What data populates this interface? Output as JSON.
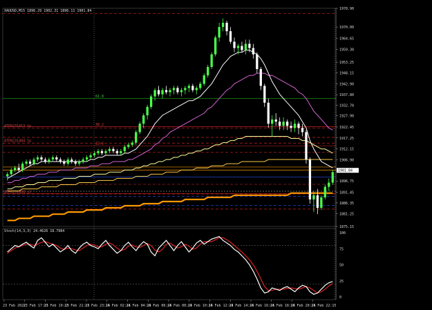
{
  "symbol_header": "XAUUSD,M15  1896.29 1902.31 1896.11 1901.84",
  "stoch_header": "Stoch(14,3,3) 24.4626 18.7984",
  "price_axis": {
    "ticks": [
      {
        "v": 1978.9,
        "t": "1978.90"
      },
      {
        "v": 1970.0,
        "t": "1970.00"
      },
      {
        "v": 1964.65,
        "t": "1964.65"
      },
      {
        "v": 1959.3,
        "t": "1959.30"
      },
      {
        "v": 1953.25,
        "t": "1953.25"
      },
      {
        "v": 1948.15,
        "t": "1948.15"
      },
      {
        "v": 1942.9,
        "t": "1942.90"
      },
      {
        "v": 1937.8,
        "t": "1937.80"
      },
      {
        "v": 1932.7,
        "t": "1932.70"
      },
      {
        "v": 1927.9,
        "t": "1927.90"
      },
      {
        "v": 1922.45,
        "t": "1922.45"
      },
      {
        "v": 1917.25,
        "t": "1917.25"
      },
      {
        "v": 1912.15,
        "t": "1912.15"
      },
      {
        "v": 1906.9,
        "t": "1906.90"
      },
      {
        "v": 1901.84,
        "t": "1901.84"
      },
      {
        "v": 1896.75,
        "t": "1896.75"
      },
      {
        "v": 1891.45,
        "t": "1891.45"
      },
      {
        "v": 1886.35,
        "t": "1886.35"
      },
      {
        "v": 1881.25,
        "t": "1881.25"
      },
      {
        "v": 1875.15,
        "t": "1875.15"
      }
    ],
    "current": 1901.84,
    "current_label": "1901.84"
  },
  "stoch_axis": {
    "ticks": [
      {
        "v": 100,
        "t": "100"
      },
      {
        "v": 75,
        "t": "75"
      },
      {
        "v": 50,
        "t": "50"
      },
      {
        "v": 25,
        "t": "25"
      },
      {
        "v": 0,
        "t": "0"
      }
    ]
  },
  "time_axis": {
    "labels": [
      "23 Feb 2022",
      "23 Feb 17:15",
      "23 Feb 19:15",
      "23 Feb 21:15",
      "23 Feb 23:15",
      "24 Feb 02:15",
      "24 Feb 04:15",
      "24 Feb 06:15",
      "24 Feb 08:15",
      "24 Feb 10:15",
      "24 Feb 12:15",
      "24 Feb 14:15",
      "24 Feb 16:15",
      "24 Feb 18:15",
      "24 Feb 20:15",
      "24 Feb 22:15"
    ]
  },
  "levels": [
    {
      "p": 1976.5,
      "color": "#cc2222",
      "dash": "4,3",
      "label": ""
    },
    {
      "p": 1936.0,
      "color": "#22aa22",
      "dash": "",
      "label": "61.8"
    },
    {
      "p": 1922.6,
      "color": "#cc2222",
      "dash": "",
      "label": "38.2"
    },
    {
      "p": 1922.0,
      "color": "#cc2222",
      "dash": "4,3",
      "label": "ATP8231413 tp"
    },
    {
      "p": 1914.8,
      "color": "#cc2222",
      "dash": "4,3",
      "label": "ATP8231404 tp"
    },
    {
      "p": 1917.5,
      "color": "#cc2222",
      "dash": "4,3",
      "label": ""
    },
    {
      "p": 1913.5,
      "color": "#aa2222",
      "dash": "",
      "label": "23.6"
    },
    {
      "p": 1910.5,
      "color": "#cc2222",
      "dash": "4,3",
      "label": ""
    },
    {
      "p": 1903.4,
      "color": "#ff9900",
      "dash": "",
      "label": ""
    },
    {
      "p": 1902.0,
      "color": "#ff9900",
      "dash": "",
      "label": ""
    },
    {
      "p": 1898.7,
      "color": "#2244cc",
      "dash": "",
      "label": ""
    },
    {
      "p": 1895.2,
      "color": "#cc2222",
      "dash": "4,3",
      "label": ""
    },
    {
      "p": 1891.9,
      "color": "#888888",
      "dash": "2,2",
      "label": ""
    },
    {
      "p": 1890.8,
      "color": "#cc2222",
      "dash": "",
      "label": ""
    },
    {
      "p": 1890.6,
      "color": "#cc2222",
      "dash": "4,3",
      "label": "ATP8231404 sl"
    },
    {
      "p": 1889.4,
      "color": "#2244cc",
      "dash": "4,3",
      "label": ""
    },
    {
      "p": 1885.2,
      "color": "#2244cc",
      "dash": "4,3",
      "label": ""
    },
    {
      "p": 1883.4,
      "color": "#cc2222",
      "dash": "4,3",
      "label": ""
    }
  ],
  "colors": {
    "bull": "#4aff4a",
    "bear": "#ffffff",
    "ma_fast": "#ffffff",
    "ma_mid": "#d264d2",
    "ma_slow1": "#ffff99",
    "ma_slow2": "#ffcc44",
    "ma_slow3": "#ff9900",
    "stoch_main": "#ffffff",
    "stoch_signal": "#dd2222",
    "current_bg": "#ffffff"
  },
  "chart_data": {
    "type": "candlestick",
    "symbol": "XAUUSD",
    "timeframe": "M15",
    "ylim": [
      1875.15,
      1978.9
    ],
    "candles": [
      [
        1899,
        1901,
        1897,
        1900
      ],
      [
        1900,
        1903,
        1899,
        1902
      ],
      [
        1902,
        1904,
        1901,
        1903
      ],
      [
        1903,
        1905,
        1901,
        1902
      ],
      [
        1902,
        1906,
        1901,
        1905
      ],
      [
        1905,
        1907,
        1904,
        1906
      ],
      [
        1906,
        1907,
        1904,
        1905
      ],
      [
        1905,
        1908,
        1904,
        1907
      ],
      [
        1907,
        1909,
        1906,
        1908
      ],
      [
        1908,
        1909,
        1906,
        1907
      ],
      [
        1907,
        1908,
        1905,
        1906
      ],
      [
        1906,
        1908,
        1905,
        1907
      ],
      [
        1907,
        1909,
        1906,
        1908
      ],
      [
        1908,
        1909,
        1906,
        1907
      ],
      [
        1907,
        1908,
        1905,
        1906
      ],
      [
        1906,
        1907,
        1904,
        1905
      ],
      [
        1905,
        1908,
        1904,
        1907
      ],
      [
        1907,
        1908,
        1905,
        1906
      ],
      [
        1906,
        1907,
        1904,
        1905
      ],
      [
        1905,
        1907,
        1904,
        1906
      ],
      [
        1906,
        1908,
        1905,
        1907
      ],
      [
        1907,
        1909,
        1906,
        1908
      ],
      [
        1908,
        1910,
        1907,
        1909
      ],
      [
        1909,
        1911,
        1908,
        1910
      ],
      [
        1910,
        1912,
        1909,
        1911
      ],
      [
        1911,
        1912,
        1909,
        1910
      ],
      [
        1910,
        1912,
        1909,
        1911
      ],
      [
        1911,
        1913,
        1910,
        1912
      ],
      [
        1912,
        1913,
        1910,
        1911
      ],
      [
        1911,
        1912,
        1909,
        1910
      ],
      [
        1910,
        1912,
        1909,
        1911
      ],
      [
        1911,
        1914,
        1910,
        1913
      ],
      [
        1913,
        1915,
        1912,
        1914
      ],
      [
        1914,
        1916,
        1913,
        1915
      ],
      [
        1915,
        1921,
        1914,
        1920
      ],
      [
        1920,
        1925,
        1919,
        1924
      ],
      [
        1924,
        1929,
        1922,
        1928
      ],
      [
        1928,
        1933,
        1926,
        1932
      ],
      [
        1932,
        1938,
        1931,
        1937
      ],
      [
        1937,
        1941,
        1935,
        1940
      ],
      [
        1940,
        1942,
        1937,
        1938
      ],
      [
        1938,
        1941,
        1936,
        1940
      ],
      [
        1940,
        1942,
        1938,
        1939
      ],
      [
        1939,
        1941,
        1937,
        1940
      ],
      [
        1940,
        1942,
        1938,
        1941
      ],
      [
        1941,
        1942,
        1938,
        1939
      ],
      [
        1939,
        1941,
        1937,
        1940
      ],
      [
        1940,
        1942,
        1938,
        1941
      ],
      [
        1941,
        1943,
        1939,
        1942
      ],
      [
        1942,
        1943,
        1939,
        1940
      ],
      [
        1940,
        1942,
        1938,
        1941
      ],
      [
        1941,
        1944,
        1940,
        1943
      ],
      [
        1943,
        1948,
        1942,
        1947
      ],
      [
        1947,
        1952,
        1946,
        1951
      ],
      [
        1951,
        1958,
        1950,
        1957
      ],
      [
        1957,
        1966,
        1956,
        1965
      ],
      [
        1965,
        1972,
        1963,
        1970
      ],
      [
        1970,
        1974,
        1968,
        1972
      ],
      [
        1972,
        1973,
        1966,
        1968
      ],
      [
        1968,
        1970,
        1962,
        1963
      ],
      [
        1963,
        1965,
        1958,
        1960
      ],
      [
        1960,
        1962,
        1957,
        1961
      ],
      [
        1961,
        1963,
        1958,
        1959
      ],
      [
        1959,
        1964,
        1957,
        1962
      ],
      [
        1962,
        1964,
        1958,
        1960
      ],
      [
        1960,
        1962,
        1955,
        1957
      ],
      [
        1957,
        1958,
        1948,
        1950
      ],
      [
        1950,
        1951,
        1940,
        1942
      ],
      [
        1942,
        1943,
        1932,
        1934
      ],
      [
        1934,
        1936,
        1922,
        1924
      ],
      [
        1924,
        1928,
        1918,
        1926
      ],
      [
        1926,
        1929,
        1923,
        1925
      ],
      [
        1925,
        1927,
        1921,
        1923
      ],
      [
        1923,
        1927,
        1921,
        1925
      ],
      [
        1925,
        1926,
        1921,
        1923
      ],
      [
        1923,
        1925,
        1920,
        1922
      ],
      [
        1922,
        1926,
        1920,
        1924
      ],
      [
        1924,
        1925,
        1919,
        1922
      ],
      [
        1922,
        1924,
        1918,
        1920
      ],
      [
        1920,
        1921,
        1905,
        1907
      ],
      [
        1907,
        1908,
        1886,
        1888
      ],
      [
        1888,
        1892,
        1882,
        1890
      ],
      [
        1890,
        1893,
        1881,
        1884
      ],
      [
        1884,
        1890,
        1883,
        1889
      ],
      [
        1889,
        1895,
        1888,
        1894
      ],
      [
        1894,
        1898,
        1892,
        1896
      ],
      [
        1896,
        1902,
        1895,
        1901
      ]
    ],
    "ma_fast": [
      1898,
      1899,
      1900,
      1901,
      1902,
      1903,
      1904,
      1905,
      1905,
      1906,
      1906,
      1906,
      1906,
      1906,
      1906,
      1906,
      1906,
      1906,
      1906,
      1906,
      1906,
      1906,
      1907,
      1907,
      1908,
      1908,
      1909,
      1909,
      1909,
      1909,
      1909,
      1910,
      1910,
      1911,
      1912,
      1914,
      1916,
      1918,
      1921,
      1924,
      1926,
      1928,
      1929,
      1930,
      1931,
      1932,
      1933,
      1934,
      1935,
      1935,
      1936,
      1937,
      1939,
      1941,
      1943,
      1946,
      1949,
      1952,
      1954,
      1956,
      1957,
      1958,
      1958,
      1959,
      1959,
      1958,
      1957,
      1955,
      1952,
      1948,
      1944,
      1941,
      1938,
      1936,
      1934,
      1932,
      1930,
      1928,
      1925,
      1922,
      1916,
      1912,
      1909,
      1906,
      1905,
      1904,
      1903
    ],
    "ma_mid": [
      1896,
      1896,
      1897,
      1897,
      1898,
      1898,
      1899,
      1899,
      1900,
      1900,
      1900,
      1901,
      1901,
      1901,
      1902,
      1902,
      1902,
      1902,
      1903,
      1903,
      1903,
      1903,
      1904,
      1904,
      1904,
      1905,
      1905,
      1905,
      1906,
      1906,
      1906,
      1906,
      1907,
      1907,
      1908,
      1909,
      1910,
      1911,
      1912,
      1914,
      1915,
      1917,
      1918,
      1920,
      1921,
      1922,
      1923,
      1924,
      1925,
      1926,
      1927,
      1928,
      1929,
      1931,
      1932,
      1934,
      1936,
      1938,
      1940,
      1941,
      1943,
      1944,
      1945,
      1946,
      1947,
      1947,
      1948,
      1948,
      1948,
      1947,
      1947,
      1946,
      1945,
      1944,
      1943,
      1942,
      1941,
      1939,
      1938,
      1936,
      1933,
      1930,
      1928,
      1926,
      1924,
      1922,
      1921
    ],
    "ma_slow1": [
      1893,
      1893,
      1894,
      1894,
      1894,
      1895,
      1895,
      1895,
      1896,
      1896,
      1896,
      1897,
      1897,
      1897,
      1897,
      1898,
      1898,
      1898,
      1898,
      1899,
      1899,
      1899,
      1899,
      1900,
      1900,
      1900,
      1900,
      1901,
      1901,
      1901,
      1901,
      1902,
      1902,
      1902,
      1903,
      1903,
      1904,
      1904,
      1905,
      1905,
      1906,
      1906,
      1907,
      1907,
      1908,
      1908,
      1909,
      1909,
      1910,
      1910,
      1911,
      1911,
      1912,
      1912,
      1913,
      1914,
      1914,
      1915,
      1915,
      1916,
      1916,
      1917,
      1917,
      1918,
      1918,
      1918,
      1918,
      1918,
      1918,
      1918,
      1918,
      1918,
      1918,
      1918,
      1918,
      1917,
      1917,
      1917,
      1916,
      1916,
      1915,
      1914,
      1913,
      1912,
      1912,
      1911,
      1910
    ],
    "ma_slow2": [
      1892,
      1892,
      1892,
      1892,
      1893,
      1893,
      1893,
      1893,
      1893,
      1894,
      1894,
      1894,
      1894,
      1894,
      1895,
      1895,
      1895,
      1895,
      1895,
      1896,
      1896,
      1896,
      1896,
      1896,
      1897,
      1897,
      1897,
      1897,
      1897,
      1898,
      1898,
      1898,
      1898,
      1898,
      1899,
      1899,
      1899,
      1899,
      1900,
      1900,
      1900,
      1900,
      1901,
      1901,
      1901,
      1901,
      1902,
      1902,
      1902,
      1902,
      1903,
      1903,
      1903,
      1903,
      1904,
      1904,
      1904,
      1904,
      1905,
      1905,
      1905,
      1905,
      1906,
      1906,
      1906,
      1906,
      1906,
      1906,
      1906,
      1907,
      1907,
      1907,
      1907,
      1907,
      1907,
      1907,
      1907,
      1907,
      1907,
      1907,
      1907,
      1907,
      1907,
      1907,
      1907,
      1907,
      1907
    ],
    "ma_slow3": [
      1878,
      1878,
      1878,
      1879,
      1879,
      1879,
      1879,
      1880,
      1880,
      1880,
      1880,
      1880,
      1881,
      1881,
      1881,
      1881,
      1882,
      1882,
      1882,
      1882,
      1882,
      1883,
      1883,
      1883,
      1883,
      1883,
      1884,
      1884,
      1884,
      1884,
      1884,
      1885,
      1885,
      1885,
      1885,
      1885,
      1886,
      1886,
      1886,
      1886,
      1886,
      1887,
      1887,
      1887,
      1887,
      1887,
      1887,
      1888,
      1888,
      1888,
      1888,
      1888,
      1888,
      1889,
      1889,
      1889,
      1889,
      1889,
      1889,
      1889,
      1890,
      1890,
      1890,
      1890,
      1890,
      1890,
      1890,
      1890,
      1890,
      1890,
      1890,
      1890,
      1890,
      1890,
      1890,
      1891,
      1891,
      1891,
      1891,
      1891,
      1891,
      1891,
      1891,
      1891,
      1891,
      1891,
      1891
    ],
    "stoch_main": [
      70,
      75,
      80,
      78,
      82,
      85,
      80,
      76,
      88,
      92,
      85,
      78,
      82,
      76,
      70,
      74,
      80,
      72,
      68,
      76,
      82,
      85,
      80,
      78,
      75,
      82,
      88,
      80,
      74,
      68,
      72,
      80,
      85,
      78,
      72,
      80,
      86,
      82,
      70,
      64,
      76,
      82,
      88,
      80,
      72,
      80,
      86,
      78,
      70,
      76,
      84,
      88,
      82,
      86,
      90,
      92,
      94,
      88,
      84,
      80,
      74,
      70,
      64,
      58,
      50,
      40,
      28,
      14,
      6,
      8,
      14,
      12,
      10,
      14,
      16,
      12,
      8,
      14,
      18,
      16,
      8,
      4,
      6,
      12,
      18,
      22,
      24
    ],
    "stoch_signal": [
      68,
      72,
      76,
      78,
      80,
      82,
      82,
      80,
      82,
      85,
      86,
      84,
      82,
      80,
      76,
      74,
      76,
      75,
      73,
      72,
      76,
      80,
      82,
      81,
      78,
      78,
      82,
      84,
      81,
      76,
      72,
      74,
      79,
      81,
      78,
      77,
      80,
      83,
      80,
      73,
      70,
      74,
      82,
      84,
      80,
      76,
      78,
      82,
      79,
      74,
      76,
      82,
      86,
      86,
      86,
      89,
      92,
      92,
      89,
      85,
      80,
      75,
      70,
      64,
      58,
      50,
      40,
      28,
      16,
      10,
      10,
      12,
      12,
      12,
      13,
      14,
      13,
      12,
      14,
      16,
      14,
      10,
      6,
      8,
      12,
      17,
      21
    ]
  }
}
